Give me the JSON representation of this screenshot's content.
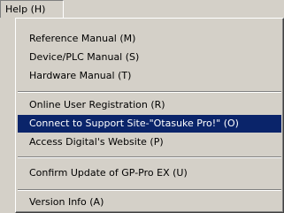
{
  "menubar": {
    "help_label": "Help (H)"
  },
  "help_menu": {
    "items": [
      {
        "label": "Reference Manual (M)"
      },
      {
        "label": "Device/PLC Manual (S)"
      },
      {
        "label": "Hardware Manual (T)"
      },
      {
        "label": "Online User Registration (R)"
      },
      {
        "label": "Connect to Support Site-\"Otasuke Pro!\" (O)",
        "highlighted": true
      },
      {
        "label": "Access Digital's Website (P)"
      },
      {
        "label": "Confirm Update of GP-Pro EX (U)"
      },
      {
        "label": "Version Info (A)"
      }
    ]
  },
  "colors": {
    "highlight_bg": "#0a246a",
    "highlight_text": "#ffffff",
    "menu_bg": "#d4d0c8"
  }
}
